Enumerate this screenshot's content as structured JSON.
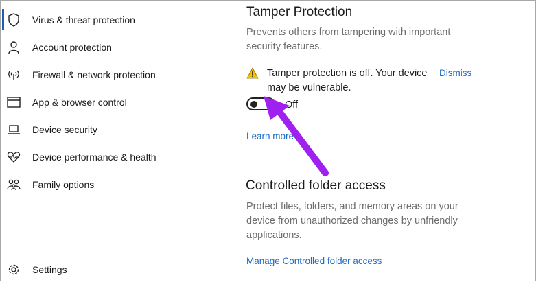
{
  "sidebar": {
    "items": [
      {
        "label": "Virus & threat protection",
        "icon": "shield-icon",
        "active": true
      },
      {
        "label": "Account protection",
        "icon": "person-icon"
      },
      {
        "label": "Firewall & network protection",
        "icon": "antenna-icon"
      },
      {
        "label": "App & browser control",
        "icon": "browser-window-icon"
      },
      {
        "label": "Device security",
        "icon": "laptop-icon"
      },
      {
        "label": "Device performance & health",
        "icon": "heart-pulse-icon"
      },
      {
        "label": "Family options",
        "icon": "family-icon"
      }
    ],
    "settings": {
      "label": "Settings",
      "icon": "gear-icon"
    }
  },
  "tamper": {
    "title": "Tamper Protection",
    "description": "Prevents others from tampering with important security features.",
    "warning": "Tamper protection is off. Your device may be vulnerable.",
    "dismiss": "Dismiss",
    "toggle_state": "Off",
    "learn_more": "Learn more"
  },
  "controlled": {
    "title": "Controlled folder access",
    "description": "Protect files, folders, and memory areas on your device from unauthorized changes by unfriendly applications.",
    "manage_link": "Manage Controlled folder access"
  },
  "colors": {
    "accent": "#1c6bc7",
    "arrow": "#a020f0",
    "warning": "#f2c200"
  }
}
